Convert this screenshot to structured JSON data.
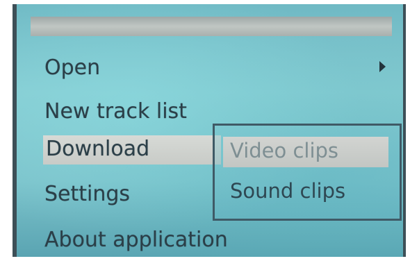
{
  "menu": {
    "items": [
      {
        "label": "Open"
      },
      {
        "label": "New track list"
      },
      {
        "label": "Download"
      },
      {
        "label": "Settings"
      },
      {
        "label": "About application"
      }
    ],
    "selected": "Download"
  },
  "submenu": {
    "items": [
      {
        "label": "Video clips"
      },
      {
        "label": "Sound clips"
      }
    ],
    "selected": "Video clips"
  },
  "icons": {
    "open_arrow": "arrow-right-icon"
  },
  "colors": {
    "screen_bg": "#7cc3cb",
    "text": "#2b3f48",
    "highlight": "#d2d4d1",
    "submenu_border": "#3f5a66"
  }
}
